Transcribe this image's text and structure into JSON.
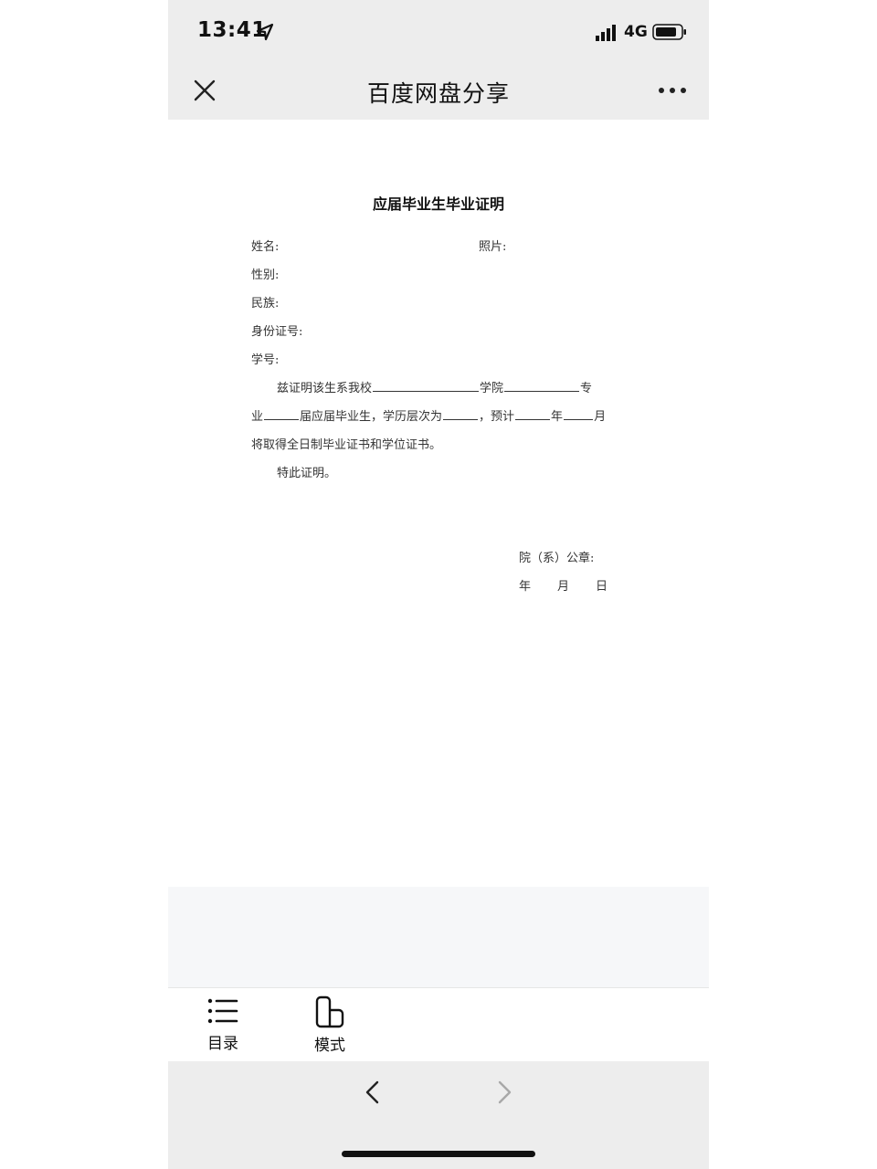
{
  "status_bar": {
    "time": "13:41",
    "network": "4G",
    "icons": [
      "location-arrow-icon",
      "signal-icon",
      "battery-icon"
    ]
  },
  "nav_bar": {
    "title": "百度网盘分享",
    "close_icon": "close-icon",
    "more_icon": "more-icon"
  },
  "document": {
    "title": "应届毕业生毕业证明",
    "fields": {
      "name": "姓名:",
      "photo": "照片:",
      "gender": "性别:",
      "ethnicity": "民族:",
      "id_number": "身份证号:",
      "student_id": "学号:"
    },
    "body": {
      "p1_a": "兹证明该生系我校",
      "p1_b": "学院",
      "p1_c": "专",
      "p2_a": "业",
      "p2_b": "届应届毕业生，学历层次为",
      "p2_c": "，预计",
      "p2_d": "年",
      "p2_e": "月",
      "p3": "将取得全日制毕业证书和学位证书。",
      "p4": "特此证明。"
    },
    "signature": {
      "seal": "院（系）公章:",
      "year": "年",
      "month": "月",
      "day": "日"
    }
  },
  "toolbar": {
    "toc_label": "目录",
    "mode_label": "模式"
  },
  "browser_nav": {
    "back_icon": "chevron-left-icon",
    "forward_icon": "chevron-right-icon"
  }
}
